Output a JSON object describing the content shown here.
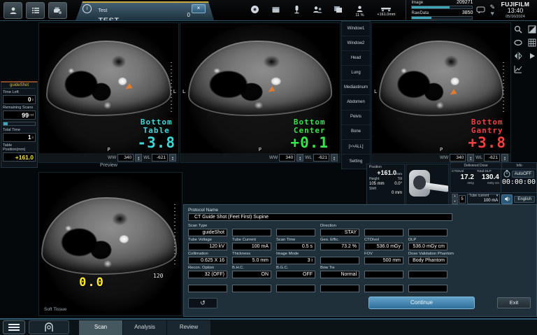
{
  "topbar": {
    "patient_tab": {
      "name": "Test",
      "id": "TEST",
      "count": "0"
    },
    "tube_usage": "11 %",
    "table_pos": "+161.0mm",
    "image_label": "Image",
    "image_value": "209271",
    "rawdata_label": "RawData",
    "rawdata_value": "3850",
    "brand": "FUJIFILM",
    "time": "13:40",
    "date": "05/16/2024"
  },
  "icons": {
    "info": "i",
    "close": "×",
    "dropdown": "▾",
    "spin_up": "▴",
    "spin_down": "▾",
    "undo": "↺",
    "pencil": "✎",
    "heart": "♥"
  },
  "scan_panel": {
    "title": "guideShot",
    "time_left_label": "Time Left",
    "time_left_value": "0",
    "time_left_unit": "s",
    "remaining_label": "Remaining Scans",
    "remaining_value": "99",
    "remaining_unit": "rot",
    "total_time_label": "Total Time",
    "total_time_value": "1",
    "total_time_unit": "s",
    "table_label": "Table Position(mm)",
    "table_value": "+161.0"
  },
  "viewports": {
    "preview_label": "Preview",
    "ww_label": "WW",
    "wl_label": "WL",
    "items": [
      {
        "line1": "Bottom",
        "line2": "Table",
        "value": "-3.8",
        "ww": "340",
        "wl": "-621",
        "orient_side": "L",
        "orient_bottom": "P"
      },
      {
        "line1": "Bottom",
        "line2": "Center",
        "value": "+0.1",
        "ww": "340",
        "wl": "-621",
        "orient_side": "L",
        "orient_bottom": "P"
      },
      {
        "line1": "Bottom",
        "line2": "Gantry",
        "value": "+3.8",
        "ww": "340",
        "wl": "-621",
        "orient_side": "L",
        "orient_bottom": "P"
      }
    ],
    "bottom": {
      "label": "Soft Tissue",
      "value": "0.0",
      "scale": "120"
    }
  },
  "window_menu": {
    "items": [
      "Window1",
      "Window2",
      "Head",
      "Lung",
      "Mediastinum",
      "Abdomen",
      "Pelvis",
      "Bone",
      "[>>ALL]",
      "Setting"
    ]
  },
  "position_panel": {
    "title": "Position",
    "value": "+161.0",
    "unit": "mm",
    "height_label": "Height",
    "height_value": "105 mm",
    "tilt_label": "Tilt",
    "tilt_value": "0.0°",
    "shift_label": "Shift",
    "shift_value": "0 mm"
  },
  "dose_panel": {
    "title": "Delivered Dose",
    "info_title": "Info",
    "ctdi_label": "CTDIvol",
    "ctdi_value": "17.2",
    "ctdi_unit": "mGy",
    "dlp_label": "Total DLP",
    "dlp_value": "130.4",
    "dlp_unit": "mGy cm",
    "autooff": "AutoOFF",
    "timer": "00:00:00",
    "seq_value": "5",
    "tube_current_label": "Tube current",
    "tube_current_value": "100 mA",
    "language": "English"
  },
  "protocol": {
    "name_label": "Protocol Name",
    "name": "CT Guide Shot (Feet First) Supine",
    "continue_label": "Continue",
    "exit_label": "Exit",
    "fields": [
      {
        "label": "Scan Type",
        "value": "guideShot"
      },
      {
        "label": "",
        "value": ""
      },
      {
        "label": "",
        "value": ""
      },
      {
        "label": "Direction",
        "value": "STAY"
      },
      {
        "label": "",
        "value": ""
      },
      {
        "label": "",
        "value": ""
      },
      {
        "label": "Tube Voltage",
        "value": "120 kV"
      },
      {
        "label": "Tube Current",
        "value": "100 mA"
      },
      {
        "label": "Scan Time",
        "value": "0.5 s"
      },
      {
        "label": "Geo. Effic.",
        "value": "73.2 %"
      },
      {
        "label": "CTDIvol",
        "value": "536.0 mGy"
      },
      {
        "label": "DLP",
        "value": "536.0 mGy cm"
      },
      {
        "label": "Collimation",
        "value": "0.625 X 16"
      },
      {
        "label": "Thickness",
        "value": "5.0 mm"
      },
      {
        "label": "Image Mode",
        "value": "3 i"
      },
      {
        "label": "",
        "value": ""
      },
      {
        "label": "FOV",
        "value": "500 mm"
      },
      {
        "label": "Dose Validation Phantom",
        "value": "Body Phantom"
      },
      {
        "label": "Recon. Option",
        "value": "32 (OFF)"
      },
      {
        "label": "B.H.C.",
        "value": "ON"
      },
      {
        "label": "B.G.C.",
        "value": "OFF"
      },
      {
        "label": "Bow Tie",
        "value": "Normal"
      },
      {
        "label": "",
        "value": ""
      },
      {
        "label": "",
        "value": ""
      },
      {
        "label": "",
        "value": ""
      },
      {
        "label": "",
        "value": ""
      },
      {
        "label": "",
        "value": ""
      },
      {
        "label": "",
        "value": ""
      },
      {
        "label": "",
        "value": ""
      },
      {
        "label": "",
        "value": ""
      }
    ]
  },
  "taskbar": {
    "tabs": [
      "Scan",
      "Analysis",
      "Review"
    ]
  }
}
